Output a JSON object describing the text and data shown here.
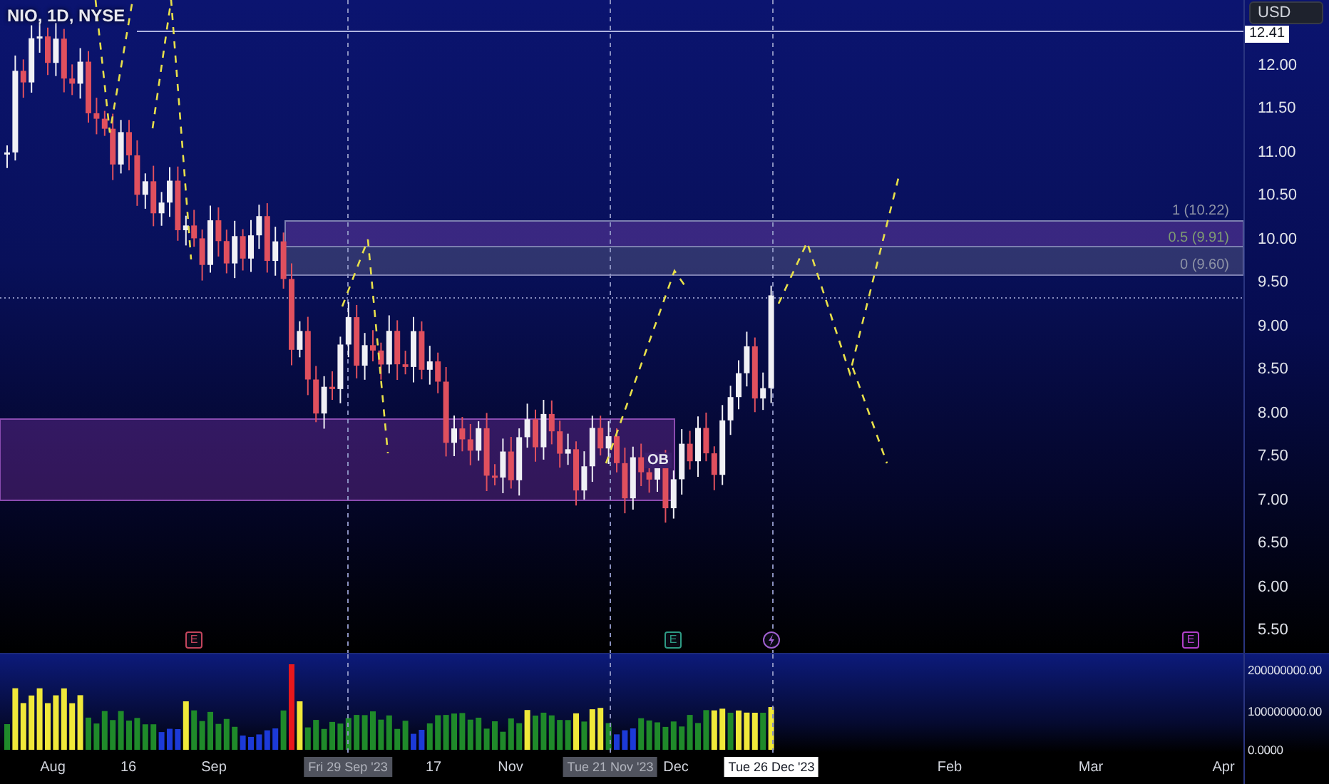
{
  "chart_title": "NIO, 1D, NYSE",
  "currency_button": "USD",
  "price_axis": {
    "current_label": "12.41",
    "ticks": [
      "12.00",
      "11.50",
      "11.00",
      "10.50",
      "10.00",
      "9.50",
      "9.00",
      "8.50",
      "8.00",
      "7.50",
      "7.00",
      "6.50",
      "6.00",
      "5.50"
    ]
  },
  "fib_levels": [
    {
      "label": "1 (10.22)",
      "color": "#8e93a6"
    },
    {
      "label": "0.5 (9.91)",
      "color": "#7e9c72"
    },
    {
      "label": "0 (9.60)",
      "color": "#8e93a6"
    }
  ],
  "order_block": {
    "label": "OB"
  },
  "events": [
    {
      "kind": "earnings",
      "label": "E",
      "color": "#c2455c"
    },
    {
      "kind": "earnings",
      "label": "E",
      "color": "#2e9a84"
    },
    {
      "kind": "flash",
      "color": "#a060d0"
    },
    {
      "kind": "earnings",
      "label": "E",
      "color": "#b040c8"
    }
  ],
  "volume_axis": {
    "ticks": [
      "200000000.00",
      "100000000.00",
      "0.0000"
    ]
  },
  "time_axis": {
    "ticks": [
      "Aug",
      "16",
      "Sep",
      "17",
      "Nov",
      "Dec",
      "Feb",
      "Mar",
      "Apr"
    ],
    "crosshair_labels": [
      {
        "label": "Fri 29 Sep '23",
        "selected": false
      },
      {
        "label": "Tue 21 Nov '23",
        "selected": false
      },
      {
        "label": "Tue 26 Dec '23",
        "selected": true
      }
    ]
  }
}
